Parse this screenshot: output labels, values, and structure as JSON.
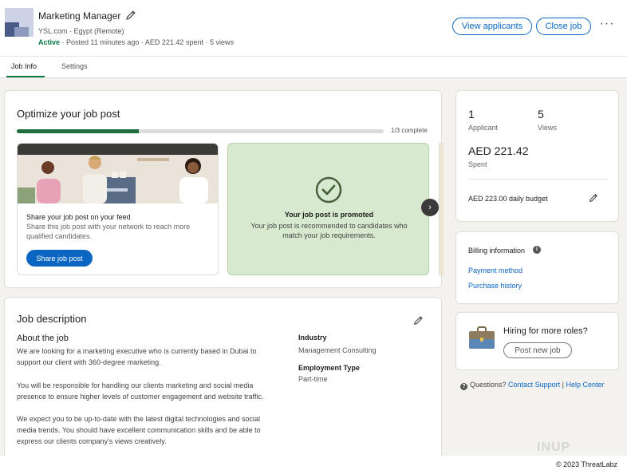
{
  "header": {
    "title": "Marketing Manager",
    "company_location": "YSL.com · Egypt (Remote)",
    "status": "Active",
    "meta": " · Posted 11 minutes ago · AED 221.42 spent · 5 views",
    "view_applicants": "View applicants",
    "close_job": "Close job",
    "more": "···"
  },
  "tabs": [
    {
      "label": "Job Info"
    },
    {
      "label": "Settings"
    }
  ],
  "optimize": {
    "title": "Optimize your job post",
    "progress_text": "1/3 complete",
    "progress_fraction": 0.333,
    "share_heading": "Share your job post on your feed",
    "share_desc": "Share this job post with your network to reach more qualified candidates.",
    "share_button": "Share job post",
    "promo_heading": "Your job post is promoted",
    "promo_desc": "Your job post is recommended to candidates who match your job requirements.",
    "next_icon": "›"
  },
  "description": {
    "title": "Job description",
    "subtitle": "About the job",
    "p1": "We are looking for a marketing executive who is currently based in Dubai to support our client with 360-degree marketing.",
    "p2": "You will be responsible for handling our clients marketing and social media presence to ensure higher levels of customer engagement and website traffic.",
    "p3": "We expect you to be up-to-date with the latest digital technologies and social media trends. You should have excellent communication skills and be able to express our clients company's views creatively.",
    "industry_label": "Industry",
    "industry_value": "Management Consulting",
    "employment_label": "Employment Type",
    "employment_value": "Part-time"
  },
  "stats": {
    "applicants_value": "1",
    "applicants_label": "Applicant",
    "views_value": "5",
    "views_label": "Views",
    "spent_value": "AED 221.42",
    "spent_label": "Spent",
    "budget": "AED 223.00 daily budget"
  },
  "billing": {
    "title": "Billing information",
    "payment_method": "Payment method",
    "purchase_history": "Purchase history"
  },
  "hire": {
    "title": "Hiring for more roles?",
    "button": "Post new job"
  },
  "help": {
    "question": "Questions?",
    "contact": "Contact Support",
    "separator": "|",
    "help_center": "Help Center"
  },
  "watermark": "INUP",
  "copyright": "© 2023 ThreatLabz",
  "colors": {
    "brand_blue": "#0a66c2",
    "active_green": "#057642",
    "promo_bg": "#d7e9cf",
    "progress_green": "#1f6e3d"
  },
  "icons": {
    "edit": "pencil-icon",
    "info": "info-icon",
    "check": "check-circle-icon",
    "briefcase": "briefcase-icon",
    "question": "question-icon"
  }
}
